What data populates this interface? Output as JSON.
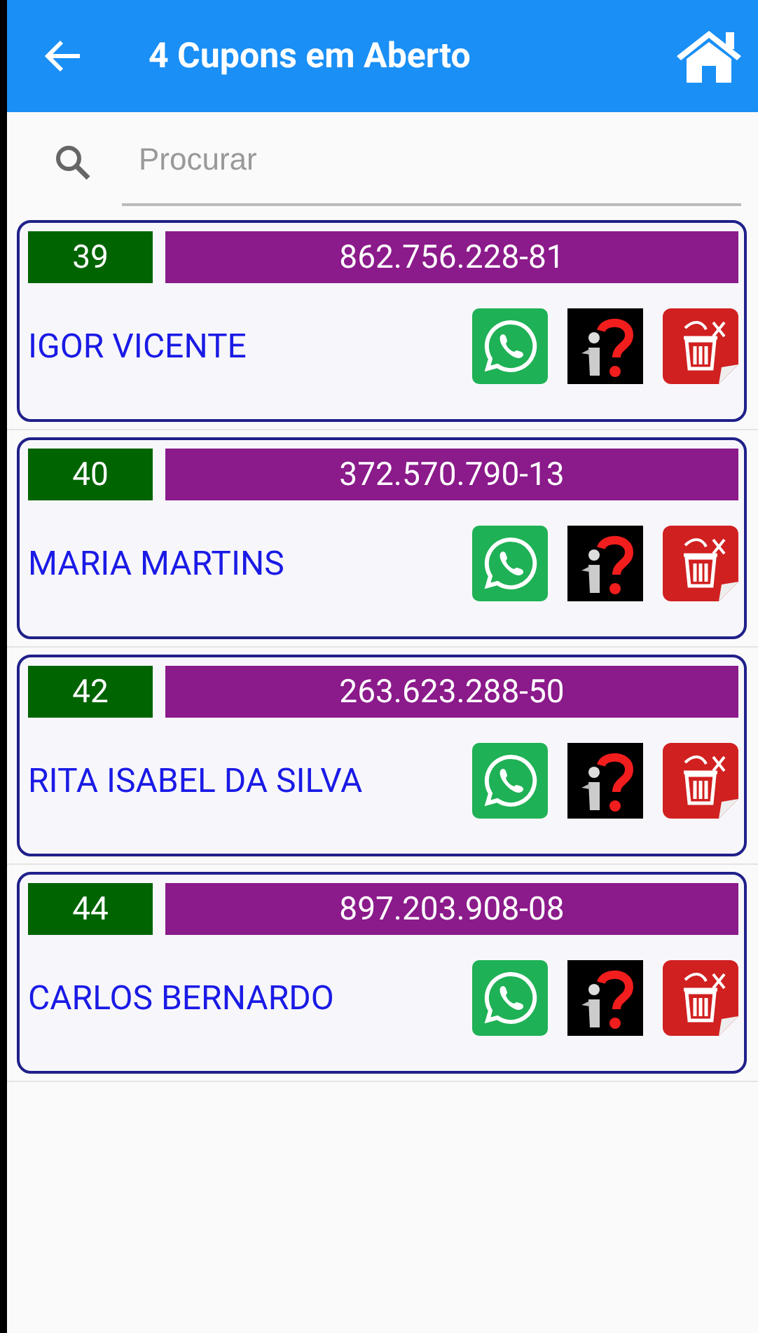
{
  "app_bar": {
    "title": "4 Cupons em Aberto"
  },
  "search": {
    "placeholder": "Procurar"
  },
  "coupons": [
    {
      "number": "39",
      "cpf": "862.756.228-81",
      "name": "IGOR VICENTE"
    },
    {
      "number": "40",
      "cpf": "372.570.790-13",
      "name": "MARIA MARTINS"
    },
    {
      "number": "42",
      "cpf": "263.623.288-50",
      "name": "RITA ISABEL DA SILVA"
    },
    {
      "number": "44",
      "cpf": "897.203.908-08",
      "name": "CARLOS BERNARDO"
    }
  ]
}
